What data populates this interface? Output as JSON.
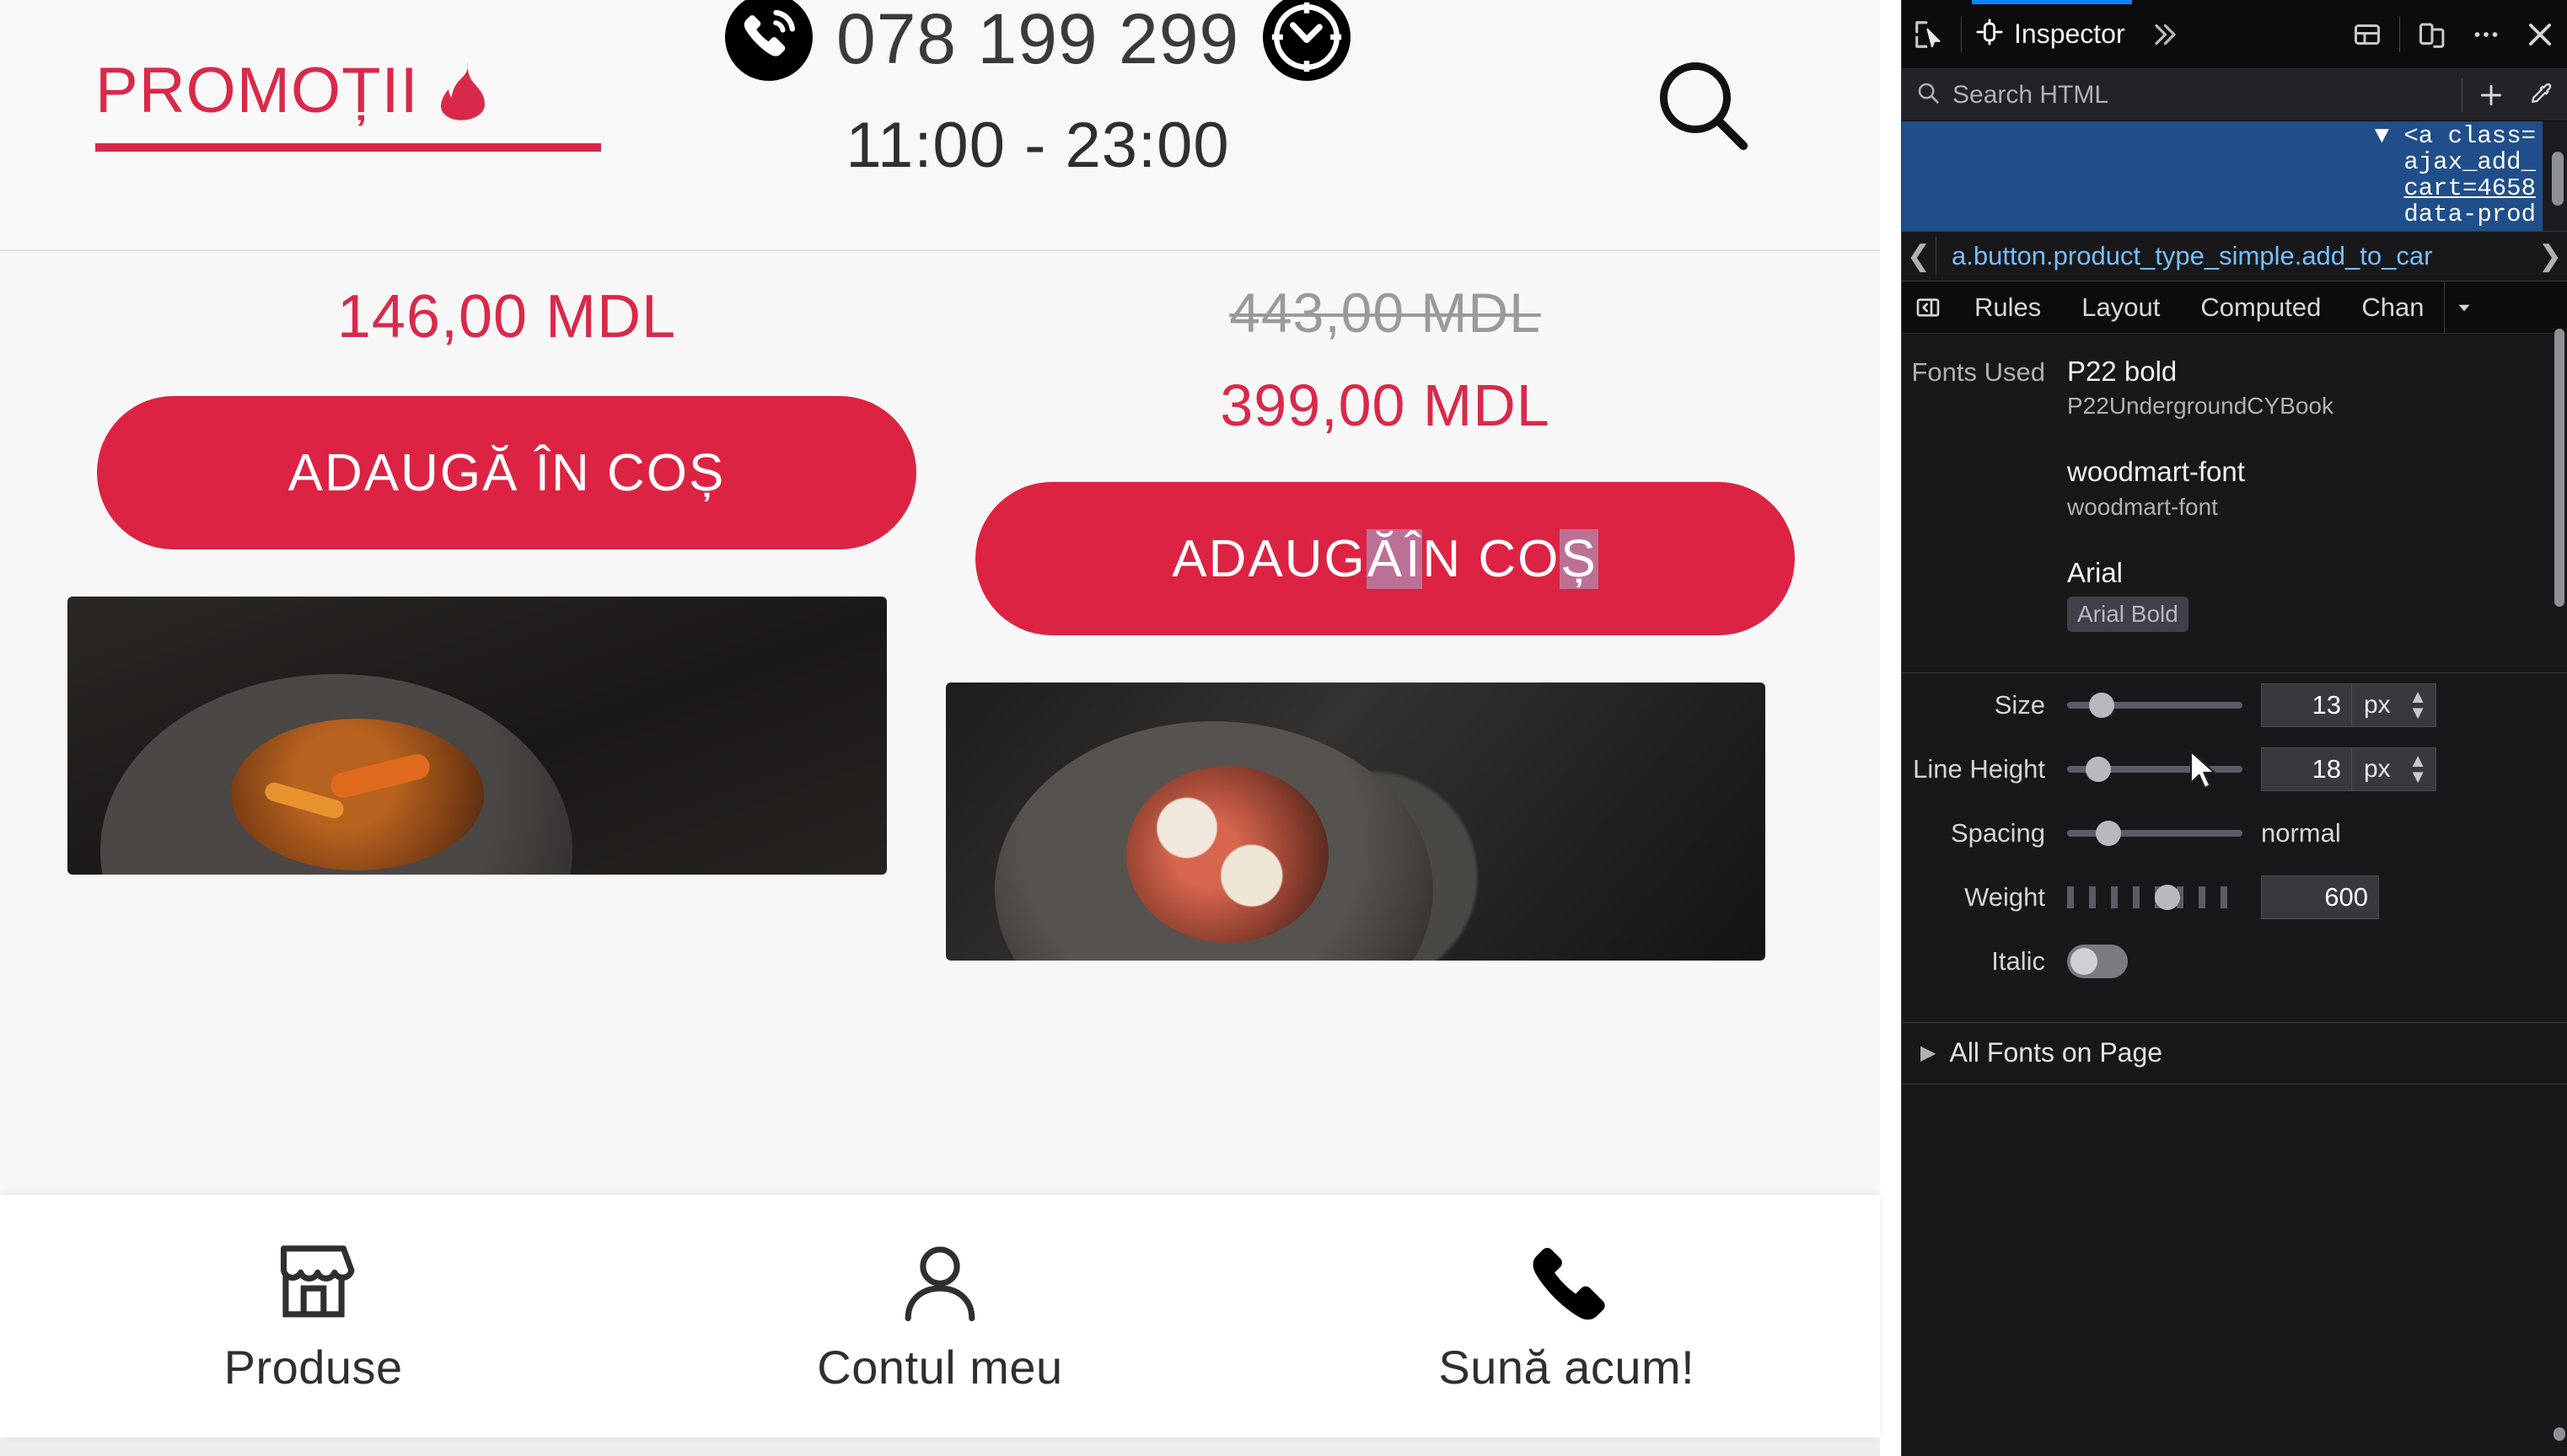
{
  "page": {
    "header": {
      "promo_title": "PROMOȚII",
      "flame_icon": "flame-icon",
      "phone_icon": "phone-circle-icon",
      "phone_number": "078 199 299",
      "clock_icon": "clock-circle-icon",
      "hours": "11:00 - 23:00",
      "search_icon": "search-icon"
    },
    "products": [
      {
        "price": "146,00 MDL",
        "old_price": null,
        "add_to_cart": "ADAUGĂ ÎN COȘ",
        "image_alt": "beef-noodle-bowl-photo"
      },
      {
        "price": "399,00 MDL",
        "old_price": "443,00 MDL",
        "add_to_cart_parts": [
          "ADAUG",
          "Ă",
          " ",
          "Î",
          "N CO",
          "Ș"
        ],
        "add_to_cart": "ADAUGĂ ÎN COȘ",
        "image_alt": "sushi-plate-photo"
      }
    ],
    "bottom_nav": [
      {
        "icon": "shop-icon",
        "label": "Produse"
      },
      {
        "icon": "user-icon",
        "label": "Contul meu"
      },
      {
        "icon": "phone-icon",
        "label": "Sună acum!"
      }
    ],
    "colors": {
      "brand_red": "#dc2343",
      "price_red": "#d9294a",
      "old_price_grey": "#9a9a9a",
      "page_bg": "#f7f7f7"
    }
  },
  "devtools": {
    "toolbar": {
      "picker_icon": "element-picker-icon",
      "tabs": [
        {
          "label": "Inspector",
          "icon": "inspector-icon",
          "active": true
        }
      ],
      "overflow_icon": "chevrons-right-icon",
      "dock_icon": "split-console-icon",
      "responsive_icon": "responsive-design-mode-icon",
      "meatball_icon": "more-options-icon",
      "close_icon": "close-icon"
    },
    "search": {
      "placeholder": "Search HTML",
      "search_icon": "search-icon",
      "add_node_icon": "plus-icon",
      "eyedropper_icon": "eyedropper-icon"
    },
    "markup": {
      "selected_node_lines": [
        "▼ <a class=",
        "ajax_add_",
        "cart=4658",
        "data-prod"
      ],
      "selected_node_line1": "▼ <a class=",
      "selected_node_line2": "ajax_add_",
      "selected_node_line3": "cart=4658",
      "selected_node_line4": "data-prod"
    },
    "breadcrumb": {
      "prev_icon": "chevron-left-icon",
      "next_icon": "chevron-right-icon",
      "item": "a.button.product_type_simple.add_to_car"
    },
    "subtabs": {
      "toggle_icon": "toggle-sidebar-icon",
      "items": [
        "Rules",
        "Layout",
        "Computed",
        "Chan"
      ],
      "more_icon": "chevron-down-icon"
    },
    "fonts": {
      "used_label": "Fonts Used",
      "entries": [
        {
          "name": "P22 bold",
          "sub": "P22UndergroundCYBook",
          "chip": null
        },
        {
          "name": "woodmart-font",
          "sub": "woodmart-font",
          "chip": null
        },
        {
          "name": "Arial",
          "sub": null,
          "chip": "Arial Bold"
        }
      ],
      "properties": [
        {
          "label": "Size",
          "value": "13",
          "unit": "px"
        },
        {
          "label": "Line Height",
          "value": "18",
          "unit": "px"
        },
        {
          "label": "Spacing",
          "value": "normal",
          "unit": null
        },
        {
          "label": "Weight",
          "value": "600",
          "unit": null
        },
        {
          "label": "Italic",
          "value": "off",
          "unit": null
        }
      ],
      "size_label": "Size",
      "size_value": "13",
      "size_unit": "px",
      "line_height_label": "Line Height",
      "line_height_value": "18",
      "line_height_unit": "px",
      "spacing_label": "Spacing",
      "spacing_value": "normal",
      "weight_label": "Weight",
      "weight_value": "600",
      "italic_label": "Italic",
      "all_fonts_label": "All Fonts on Page",
      "all_fonts_twisty": "▶"
    }
  }
}
